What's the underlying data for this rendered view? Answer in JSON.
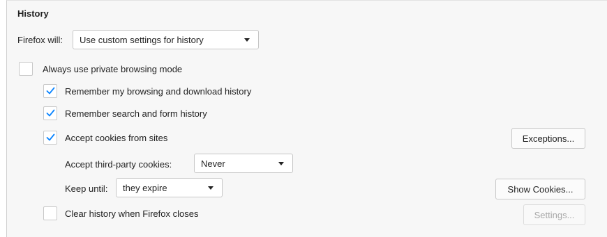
{
  "section": {
    "title": "History"
  },
  "firefox_will": {
    "label": "Firefox will:",
    "selected": "Use custom settings for history"
  },
  "private_browsing": {
    "label": "Always use private browsing mode",
    "checked": false
  },
  "remember_browsing": {
    "label": "Remember my browsing and download history",
    "checked": true
  },
  "remember_search": {
    "label": "Remember search and form history",
    "checked": true
  },
  "accept_cookies": {
    "label": "Accept cookies from sites",
    "checked": true
  },
  "exceptions_button": {
    "label": "Exceptions..."
  },
  "third_party": {
    "label": "Accept third-party cookies:",
    "selected": "Never"
  },
  "keep_until": {
    "label": "Keep until:",
    "selected": "they expire"
  },
  "show_cookies_button": {
    "label": "Show Cookies..."
  },
  "clear_history": {
    "label": "Clear history when Firefox closes",
    "checked": false
  },
  "settings_button": {
    "label": "Settings...",
    "disabled": true
  },
  "colors": {
    "checkmark": "#0a84ff",
    "panel_bg": "#f7f7f7",
    "disabled_text": "#a8a8a8"
  },
  "icons": {
    "checkmark": "checkmark-icon",
    "dropdown": "chevron-down-icon"
  }
}
